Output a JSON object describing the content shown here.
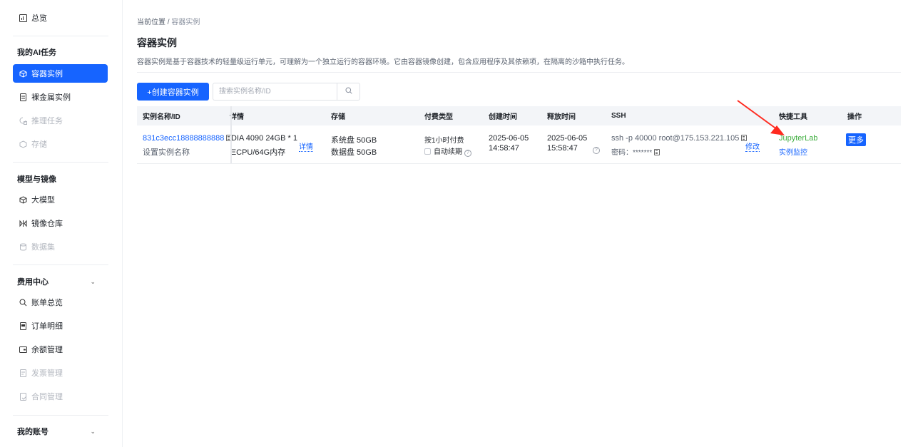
{
  "sidebar": {
    "overview": {
      "label": "总览",
      "icon": "dashboard-icon"
    },
    "groups": {
      "ai_tasks": {
        "title": "我的AI任务"
      },
      "models": {
        "title": "模型与镜像"
      },
      "billing": {
        "title": "费用中心",
        "chevron": "⌄"
      },
      "account": {
        "title": "我的账号",
        "chevron": "⌄"
      }
    },
    "items": {
      "container": {
        "label": "容器实例",
        "state": "active"
      },
      "bare_metal": {
        "label": "裸金属实例"
      },
      "inference": {
        "label": "推理任务",
        "state": "disabled"
      },
      "storage": {
        "label": "存储",
        "state": "disabled"
      },
      "large_model": {
        "label": "大模型"
      },
      "image_repo": {
        "label": "镜像仓库"
      },
      "dataset": {
        "label": "数据集",
        "state": "disabled"
      },
      "bill_overview": {
        "label": "账单总览"
      },
      "order_detail": {
        "label": "订单明细"
      },
      "balance": {
        "label": "余额管理"
      },
      "invoice": {
        "label": "发票管理",
        "state": "disabled"
      },
      "contract": {
        "label": "合同管理",
        "state": "disabled"
      }
    }
  },
  "breadcrumb": {
    "prefix": "当前位置",
    "sep": "/",
    "current": "容器实例"
  },
  "page": {
    "title": "容器实例",
    "description": "容器实例是基于容器技术的轻量级运行单元，可理解为一个独立运行的容器环境。它由容器镜像创建，包含应用程序及其依赖项，在隔离的沙箱中执行任务。"
  },
  "toolbar": {
    "create_label": "+创建容器实例",
    "search_placeholder": "搜索实例名称/ID",
    "search_value": ""
  },
  "table": {
    "headers": {
      "name": "实例名称/ID",
      "detail": "详情",
      "storage": "存储",
      "pay_type": "付费类型",
      "created": "创建时间",
      "release": "释放时间",
      "ssh": "SSH",
      "tools": "快捷工具",
      "actions": "操作"
    },
    "rows": [
      {
        "id": "831c3ecc18888888888",
        "set_name": "设置实例名称",
        "spec_line1": "DIA 4090 24GB * 1",
        "spec_line2": "ΞCPU/64G内存",
        "detail_link": "详情",
        "system_disk": "系统盘 50GB",
        "data_disk": "数据盘 50GB",
        "pay_type": "按1小时付费",
        "auto_renew": "自动续期",
        "created_date": "2025-06-05",
        "created_time": "14:58:47",
        "release_date": "2025-06-05",
        "release_time": "15:58:47",
        "ssh_cmd": "ssh -p 40000 root@175.153.221.105",
        "password_label": "密码：",
        "password_mask": "*******",
        "modify": "修改",
        "tool_jupyter": "JupyterLab",
        "tool_monitor": "实例监控",
        "more": "更多"
      }
    ]
  },
  "colors": {
    "accent": "#1664ff",
    "annotation_arrow": "#ff2a1f",
    "jupyter_green": "#3fae3f"
  }
}
